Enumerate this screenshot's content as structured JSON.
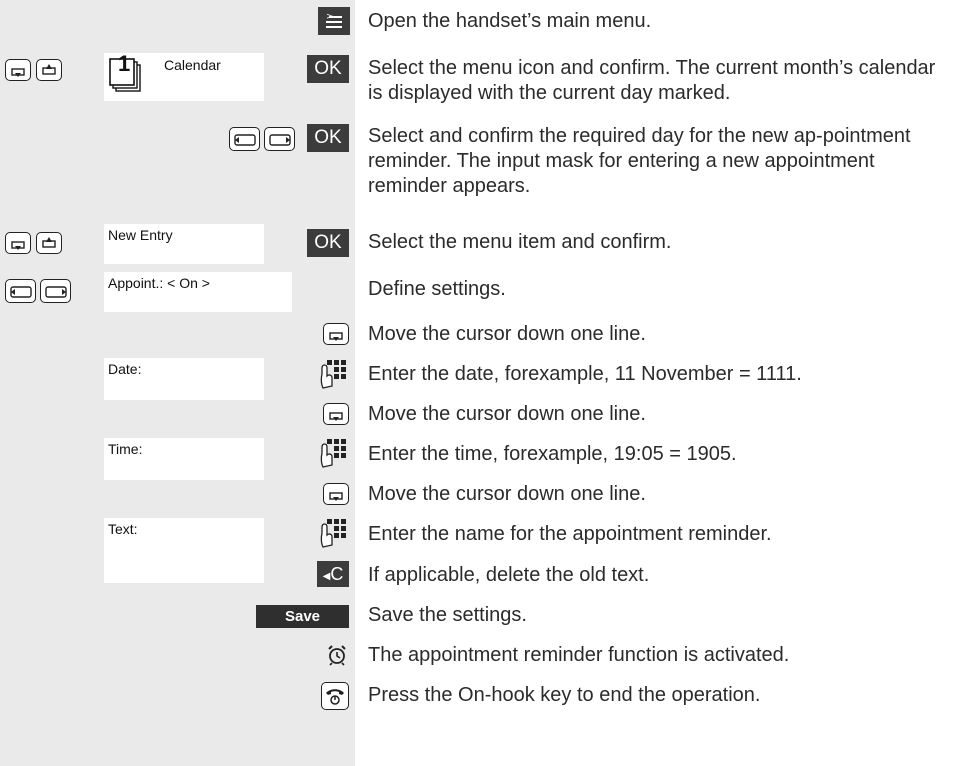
{
  "steps": [
    {
      "id": "s1",
      "key": "menu-key",
      "description": "Open the handset’s main menu."
    },
    {
      "id": "s2",
      "display": "Calendar",
      "menu_icon_number": "1",
      "key_label": "OK",
      "description": "Select the menu icon and confirm. The current month’s calendar is displayed with the current day marked."
    },
    {
      "id": "s3",
      "key_label": "OK",
      "description": "Select and confirm the required day for the new ap-pointment reminder. The input mask for entering a new appointment reminder appears."
    },
    {
      "id": "s4",
      "display": "New Entry",
      "key_label": "OK",
      "description": "Select the menu item and confirm."
    },
    {
      "id": "s5",
      "display": "Appoint.: < On >",
      "description": "Define settings."
    },
    {
      "id": "s6",
      "description": "Move the cursor down one line."
    },
    {
      "id": "s7",
      "display": "Date:",
      "description": "Enter the date, forexample, 11 November = 1111."
    },
    {
      "id": "s8",
      "description": "Move the cursor down one line."
    },
    {
      "id": "s9",
      "display": "Time:",
      "description": "Enter the time, forexample, 19:05 = 1905."
    },
    {
      "id": "s10",
      "description": "Move the cursor down one line."
    },
    {
      "id": "s11",
      "display": "Text:",
      "description": "Enter the name for the appointment reminder."
    },
    {
      "id": "s12",
      "key_label": "C",
      "description": "If applicable, delete the old text."
    },
    {
      "id": "s13",
      "key_label": "Save",
      "description": "Save the settings."
    },
    {
      "id": "s14",
      "icon": "alarm-clock-icon",
      "description": "The appointment reminder function is activated."
    },
    {
      "id": "s15",
      "icon": "on-hook-key-icon",
      "description": "Press the On-hook key to end the operation."
    }
  ]
}
